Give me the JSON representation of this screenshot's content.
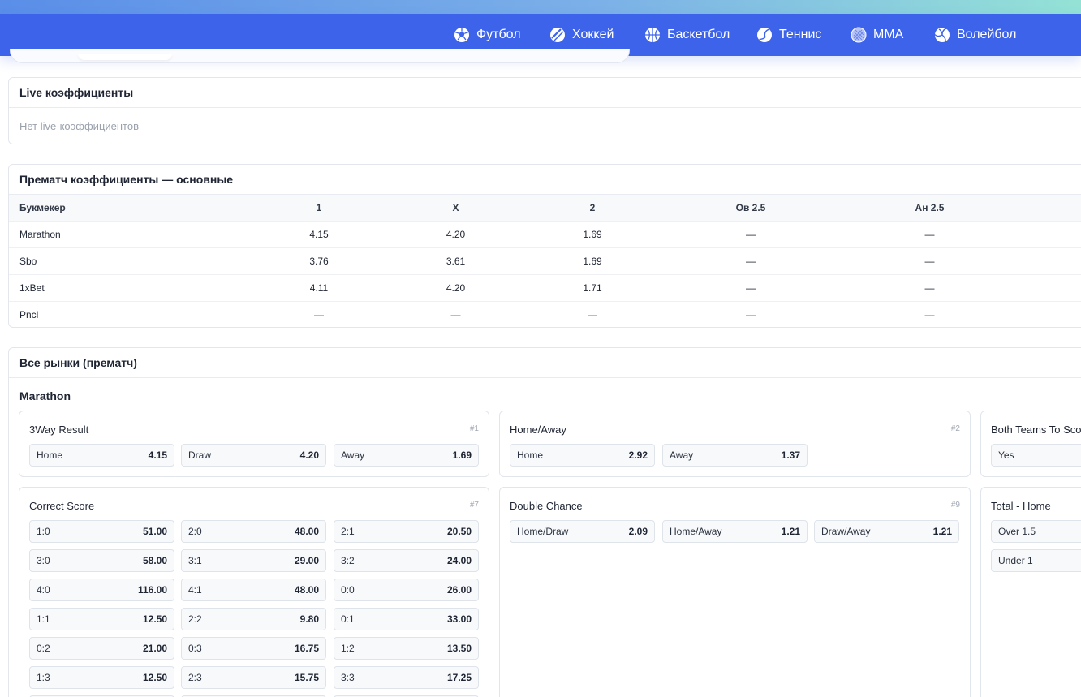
{
  "nav": {
    "items": [
      {
        "label": "Футбол",
        "icon": "soccer-ball-icon"
      },
      {
        "label": "Хоккей",
        "icon": "hockey-puck-icon"
      },
      {
        "label": "Баскетбол",
        "icon": "basketball-icon"
      },
      {
        "label": "Теннис",
        "icon": "tennis-ball-icon"
      },
      {
        "label": "MMA",
        "icon": "mma-icon"
      },
      {
        "label": "Волейбол",
        "icon": "volleyball-icon"
      }
    ]
  },
  "live": {
    "title": "Live коэффициенты",
    "empty": "Нет live-коэффициентов"
  },
  "prematch": {
    "title": "Прематч коэффициенты — основные",
    "columns": [
      "Букмекер",
      "1",
      "X",
      "2",
      "Ов 2.5",
      "Ан 2.5"
    ],
    "rows": [
      [
        "Marathon",
        "4.15",
        "4.20",
        "1.69",
        "—",
        "—"
      ],
      [
        "Sbo",
        "3.76",
        "3.61",
        "1.69",
        "—",
        "—"
      ],
      [
        "1xBet",
        "4.11",
        "4.20",
        "1.71",
        "—",
        "—"
      ],
      [
        "Pncl",
        "—",
        "—",
        "—",
        "—",
        "—"
      ]
    ]
  },
  "markets": {
    "title": "Все рынки (прематч)",
    "bookmaker": "Marathon",
    "cards": {
      "three_way": {
        "name": "3Way Result",
        "num": "#1",
        "outcomes": [
          [
            "Home",
            "4.15"
          ],
          [
            "Draw",
            "4.20"
          ],
          [
            "Away",
            "1.69"
          ]
        ]
      },
      "home_away": {
        "name": "Home/Away",
        "num": "#2",
        "outcomes": [
          [
            "Home",
            "2.92"
          ],
          [
            "Away",
            "1.37"
          ]
        ]
      },
      "btts": {
        "name": "Both Teams To Scor",
        "outcomes": [
          [
            "Yes",
            ""
          ]
        ]
      },
      "correct_score": {
        "name": "Correct Score",
        "num": "#7",
        "outcomes": [
          [
            "1:0",
            "51.00"
          ],
          [
            "2:0",
            "48.00"
          ],
          [
            "2:1",
            "20.50"
          ],
          [
            "3:0",
            "58.00"
          ],
          [
            "3:1",
            "29.00"
          ],
          [
            "3:2",
            "24.00"
          ],
          [
            "4:0",
            "116.00"
          ],
          [
            "4:1",
            "48.00"
          ],
          [
            "0:0",
            "26.00"
          ],
          [
            "1:1",
            "12.50"
          ],
          [
            "2:2",
            "9.80"
          ],
          [
            "0:1",
            "33.00"
          ],
          [
            "0:2",
            "21.00"
          ],
          [
            "0:3",
            "16.75"
          ],
          [
            "1:2",
            "13.50"
          ],
          [
            "1:3",
            "12.50"
          ],
          [
            "2:3",
            "15.75"
          ],
          [
            "3:3",
            "17.25"
          ]
        ]
      },
      "double_chance": {
        "name": "Double Chance",
        "num": "#9",
        "outcomes": [
          [
            "Home/Draw",
            "2.09"
          ],
          [
            "Home/Away",
            "1.21"
          ],
          [
            "Draw/Away",
            "1.21"
          ]
        ]
      },
      "total_home": {
        "name": "Total - Home",
        "outcomes": [
          [
            "Over 1.5",
            ""
          ],
          [
            "Under 1",
            ""
          ]
        ]
      }
    }
  }
}
